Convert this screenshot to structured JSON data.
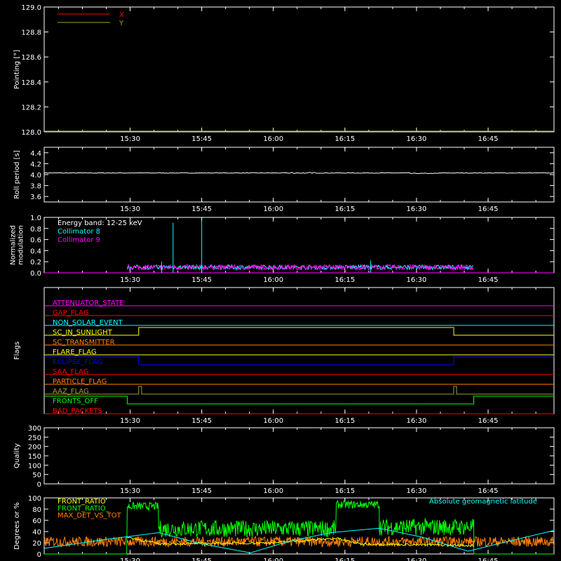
{
  "style": {
    "background": "#000000",
    "foreground": "#ffffff",
    "red": "#ff0000",
    "olive": "#a0a030",
    "cyan": "#00ffff",
    "magenta": "#ff00ff",
    "orange": "#ff8000",
    "yellow": "#ffff00",
    "blue": "#0000ff",
    "green": "#00ff00",
    "brown": "#b08040"
  },
  "chart_data": [
    {
      "id": "pointing",
      "type": "line",
      "ylabel": "Pointing [°]",
      "ylim": [
        128.0,
        129.0
      ],
      "yticks": [
        "128.0",
        "128.2",
        "128.4",
        "128.6",
        "128.8",
        "129.0"
      ],
      "xticks": [
        "15:30",
        "15:45",
        "16:00",
        "16:15",
        "16:30",
        "16:45"
      ],
      "legend_position": "top-left",
      "series": [
        {
          "name": "X",
          "color": "red",
          "values": []
        },
        {
          "name": "Y",
          "color": "olive",
          "values": [
            [
              15.2,
              128.0
            ],
            [
              16.98,
              128.0
            ]
          ]
        }
      ]
    },
    {
      "id": "roll",
      "type": "line",
      "ylabel": "Roll period [s]",
      "ylim": [
        3.5,
        4.5
      ],
      "yticks": [
        "3.6",
        "3.8",
        "4.0",
        "4.2",
        "4.4"
      ],
      "xticks": [
        "15:30",
        "15:45",
        "16:00",
        "16:15",
        "16:30",
        "16:45"
      ],
      "series": [
        {
          "color": "foreground",
          "values": [
            [
              15.2,
              4.03
            ],
            [
              15.6,
              4.03
            ],
            [
              15.61,
              4.05
            ],
            [
              15.62,
              4.03
            ],
            [
              16.05,
              4.03
            ],
            [
              16.07,
              4.04
            ],
            [
              16.1,
              4.02
            ],
            [
              16.12,
              4.04
            ],
            [
              16.3,
              4.03
            ],
            [
              16.5,
              4.02
            ],
            [
              16.55,
              4.04
            ],
            [
              16.98,
              4.03
            ]
          ]
        }
      ]
    },
    {
      "id": "modulation",
      "type": "line",
      "ylabel": "Normalized modulation",
      "ylim": [
        0.0,
        1.0
      ],
      "yticks": [
        "0.0",
        "0.2",
        "0.4",
        "0.6",
        "0.8",
        "1.0"
      ],
      "xticks": [
        "15:30",
        "15:45",
        "16:00",
        "16:15",
        "16:30",
        "16:45"
      ],
      "legend_position": "top-left",
      "annotation": "Energy band: 12-25 keV",
      "data_range": [
        15.49,
        16.7
      ],
      "typical_level": 0.1,
      "series": [
        {
          "name": "Collimator 8",
          "color": "cyan",
          "values": [
            [
              15.65,
              0.9
            ],
            [
              15.75,
              0.95
            ],
            [
              15.61,
              0.2
            ],
            [
              16.34,
              0.22
            ]
          ]
        },
        {
          "name": "Collimator 9",
          "color": "magenta",
          "values": []
        }
      ]
    },
    {
      "id": "flags",
      "type": "line",
      "ylabel": "Flags",
      "xticks": [
        "15:30",
        "15:45",
        "16:00",
        "16:15",
        "16:30",
        "16:45"
      ],
      "flags": [
        {
          "name": "ATTENUATOR_STATE",
          "color": "magenta",
          "steps": []
        },
        {
          "name": "GAP_FLAG",
          "color": "red",
          "steps": []
        },
        {
          "name": "NON_SOLAR_EVENT",
          "color": "cyan",
          "steps": []
        },
        {
          "name": "SC_IN_SUNLIGHT",
          "color": "yellow",
          "steps": [
            [
              15.2,
              0
            ],
            [
              15.53,
              1
            ],
            [
              16.63,
              0
            ]
          ]
        },
        {
          "name": "SC_TRANSMITTER",
          "color": "orange",
          "steps": []
        },
        {
          "name": "FLARE_FLAG",
          "color": "yellow",
          "steps": []
        },
        {
          "name": "ECLIPSE_FLAG",
          "color": "blue",
          "steps": [
            [
              15.2,
              1
            ],
            [
              15.53,
              0
            ],
            [
              16.63,
              1
            ]
          ]
        },
        {
          "name": "SAA_FLAG",
          "color": "red",
          "steps": []
        },
        {
          "name": "PARTICLE_FLAG",
          "color": "orange",
          "steps": []
        },
        {
          "name": "AAZ_FLAG",
          "color": "olive",
          "steps": [
            [
              15.2,
              0
            ],
            [
              15.53,
              1
            ],
            [
              15.54,
              0
            ],
            [
              16.63,
              1
            ],
            [
              16.64,
              0
            ]
          ]
        },
        {
          "name": "FRONTS_OFF",
          "color": "green",
          "steps": [
            [
              15.2,
              1
            ],
            [
              15.49,
              0
            ],
            [
              16.7,
              1
            ]
          ]
        },
        {
          "name": "BAD_PACKETS",
          "color": "red",
          "steps": []
        }
      ]
    },
    {
      "id": "quality",
      "type": "line",
      "ylabel": "Quality",
      "ylim": [
        0,
        300
      ],
      "yticks": [
        "0",
        "50",
        "100",
        "150",
        "200",
        "250",
        "300"
      ],
      "xticks": [
        "15:30",
        "15:45",
        "16:00",
        "16:15",
        "16:30",
        "16:45"
      ],
      "series": []
    },
    {
      "id": "ratios",
      "type": "line",
      "ylabel": "Degrees or %",
      "ylim": [
        0,
        100
      ],
      "yticks": [
        "0",
        "20",
        "40",
        "60",
        "80",
        "100"
      ],
      "xticks": [
        "15:30",
        "15:45",
        "16:00",
        "16:15",
        "16:30",
        "16:45"
      ],
      "legend_position": "top-left",
      "series": [
        {
          "name": "FRONT_RATIO",
          "color": "yellow",
          "values": [
            [
              15.49,
              30
            ],
            [
              15.6,
              18
            ],
            [
              16.0,
              20
            ],
            [
              16.22,
              28
            ],
            [
              16.3,
              18
            ],
            [
              16.7,
              15
            ]
          ]
        },
        {
          "name": "FRONT_RATIO_",
          "color": "green",
          "segments": [
            [
              15.2,
              15.49,
              0
            ],
            [
              15.49,
              15.6,
              85
            ],
            [
              15.6,
              16.22,
              45
            ],
            [
              16.22,
              16.37,
              88
            ],
            [
              16.37,
              16.7,
              48
            ],
            [
              16.7,
              16.98,
              0
            ]
          ]
        },
        {
          "name": "MAX_DET_VS_TOT",
          "color": "orange",
          "values": [
            [
              15.2,
              22
            ],
            [
              16.98,
              22
            ]
          ]
        },
        {
          "name": "Absolute geomagnetic latitude",
          "color": "cyan",
          "values": [
            [
              15.2,
              10
            ],
            [
              15.4,
              25
            ],
            [
              15.6,
              38
            ],
            [
              15.75,
              18
            ],
            [
              15.92,
              2
            ],
            [
              16.05,
              22
            ],
            [
              16.2,
              38
            ],
            [
              16.37,
              46
            ],
            [
              16.52,
              30
            ],
            [
              16.68,
              5
            ],
            [
              16.8,
              20
            ],
            [
              16.98,
              42
            ]
          ]
        }
      ]
    }
  ]
}
